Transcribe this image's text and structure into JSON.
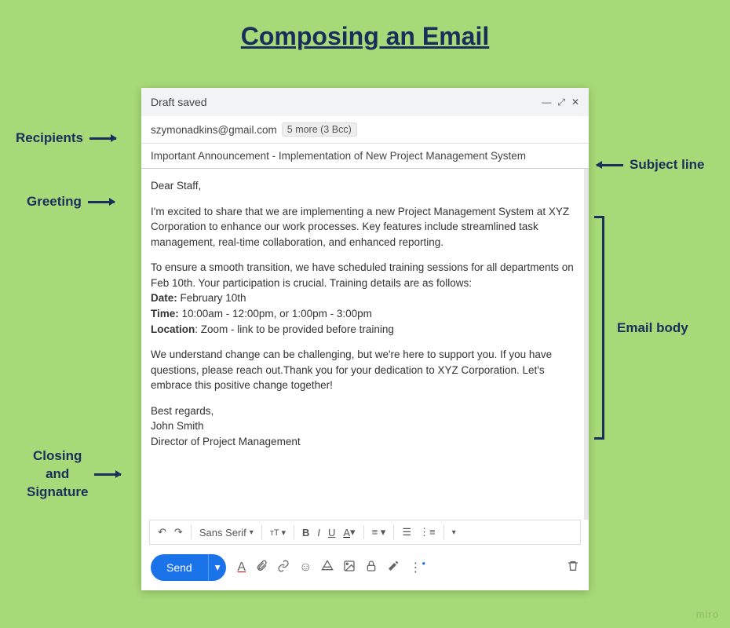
{
  "title": "Composing an Email",
  "annotations": {
    "recipients": "Recipients",
    "greeting": "Greeting",
    "closing": "Closing\nand\nSignature",
    "subject": "Subject line",
    "body": "Email body"
  },
  "compose": {
    "draft_status": "Draft saved",
    "recipient_email": "szymonadkins@gmail.com",
    "recipient_more_badge": "5 more (3 Bcc)",
    "subject": "Important Announcement - Implementation of New Project Management System",
    "greeting": "Dear Staff,",
    "para1": "I'm excited to share that we are implementing a new Project Management System at XYZ Corporation  to enhance our work processes. Key features include streamlined task management, real-time collaboration, and enhanced reporting.",
    "para2_intro": "To ensure a smooth transition, we have scheduled training sessions for all departments on Feb 10th. Your participation is crucial. Training details are as follows:",
    "date_label": "Date:",
    "date_value": " February 10th",
    "time_label": "Time:",
    "time_value": " 10:00am - 12:00pm, or 1:00pm - 3:00pm",
    "location_label": "Location",
    "location_value": ": Zoom - link to be provided before training",
    "para3": "We understand change can be challenging, but we're here to support you. If you have questions, please reach out.Thank you for your dedication to XYZ Corporation. Let's embrace this positive change together!",
    "signoff": "Best regards,",
    "sender_name": "John Smith",
    "sender_title": "Director of Project Management",
    "font_name": "Sans Serif",
    "send_label": "Send"
  },
  "watermark": "miro"
}
